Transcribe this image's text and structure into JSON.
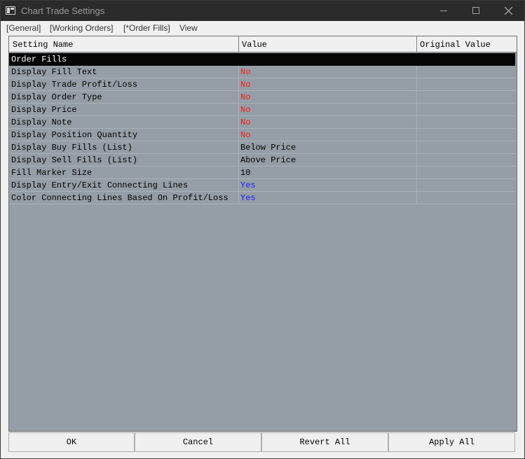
{
  "window": {
    "title": "Chart Trade Settings"
  },
  "menu": [
    "[General]",
    "[Working Orders]",
    "[*Order Fills]",
    "View"
  ],
  "grid": {
    "columns": [
      "Setting Name",
      "Value",
      "Original Value"
    ],
    "category": "Order Fills",
    "rows": [
      {
        "name": "Display Fill Text",
        "value": "No",
        "color": "#ff1a1a",
        "original": ""
      },
      {
        "name": "Display Trade Profit/Loss",
        "value": "No",
        "color": "#ff1a1a",
        "original": ""
      },
      {
        "name": "Display Order Type",
        "value": "No",
        "color": "#ff1a1a",
        "original": ""
      },
      {
        "name": "Display Price",
        "value": "No",
        "color": "#ff1a1a",
        "original": ""
      },
      {
        "name": "Display Note",
        "value": "No",
        "color": "#ff1a1a",
        "original": ""
      },
      {
        "name": "Display Position Quantity",
        "value": "No",
        "color": "#ff1a1a",
        "original": ""
      },
      {
        "name": "Display Buy Fills (List)",
        "value": "Below Price",
        "color": "#000000",
        "original": ""
      },
      {
        "name": "Display Sell Fills (List)",
        "value": "Above Price",
        "color": "#000000",
        "original": ""
      },
      {
        "name": "Fill Marker Size",
        "value": "10",
        "color": "#000000",
        "original": ""
      },
      {
        "name": "Display Entry/Exit Connecting Lines",
        "value": "Yes",
        "color": "#1a1aff",
        "original": ""
      },
      {
        "name": "Color Connecting Lines Based On Profit/Loss",
        "value": "Yes",
        "color": "#1a1aff",
        "original": ""
      }
    ]
  },
  "buttons": [
    "OK",
    "Cancel",
    "Revert All",
    "Apply All"
  ]
}
